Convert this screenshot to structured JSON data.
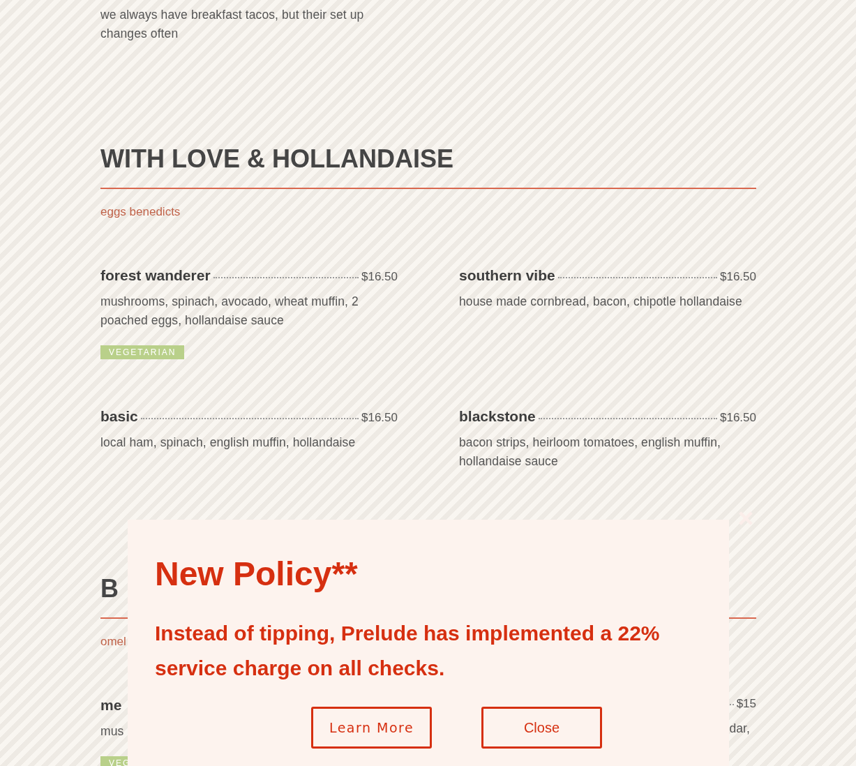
{
  "intro": {
    "text": "we always have breakfast tacos, but their set up changes often"
  },
  "sections": [
    {
      "title": "WITH LOVE & HOLLANDAISE",
      "subtitle": "eggs benedicts",
      "items": [
        {
          "name": "forest wanderer",
          "price": "$16.50",
          "description": "mushrooms, spinach, avocado, wheat muffin, 2 poached eggs, hollandaise sauce",
          "tags": [
            "VEGETARIAN"
          ]
        },
        {
          "name": "southern vibe",
          "price": "$16.50",
          "description": "house made cornbread, bacon, chipotle hollandaise"
        },
        {
          "name": "basic",
          "price": "$16.50",
          "description": "local ham, spinach, english muffin, hollandaise"
        },
        {
          "name": "blackstone",
          "price": "$16.50",
          "description": "bacon strips, heirloom tomatoes, english muffin, hollandaise sauce"
        }
      ]
    },
    {
      "title": "B",
      "subtitle": "omel",
      "items": [
        {
          "name": "me",
          "description": "mus",
          "tags": [
            "VEG"
          ]
        },
        {
          "price": "$15",
          "description": "dar,"
        }
      ]
    }
  ],
  "modal": {
    "title": "New Policy**",
    "message": "Instead of tipping, Prelude has implemented a 22% service charge on all checks.",
    "buttons": [
      {
        "label": "Learn More",
        "kind": "outline"
      },
      {
        "label": "Close",
        "kind": "outline"
      }
    ]
  }
}
